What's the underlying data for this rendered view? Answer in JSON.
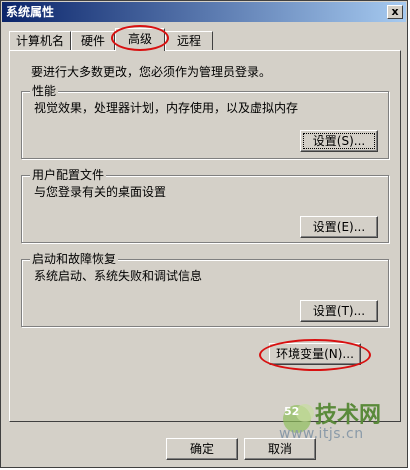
{
  "window": {
    "title": "系统属性",
    "close_glyph": "x"
  },
  "tabs": [
    {
      "label": "计算机名"
    },
    {
      "label": "硬件"
    },
    {
      "label": "高级",
      "active": true
    },
    {
      "label": "远程"
    }
  ],
  "intro_text": "要进行大多数更改，您必须作为管理员登录。",
  "groups": {
    "performance": {
      "title": "性能",
      "description": "视觉效果，处理器计划，内存使用，以及虚拟内存",
      "button": "设置(S)..."
    },
    "user_profiles": {
      "title": "用户配置文件",
      "description": "与您登录有关的桌面设置",
      "button": "设置(E)..."
    },
    "startup_recovery": {
      "title": "启动和故障恢复",
      "description": "系统启动、系统失败和调试信息",
      "button": "设置(T)..."
    }
  },
  "env_button": "环境变量(N)...",
  "footer": {
    "ok": "确定",
    "cancel": "取消"
  },
  "watermark": {
    "brand": "技术网",
    "url": "www.itjs.cn",
    "badge": "52"
  },
  "colors": {
    "annotation": "#d81010",
    "titlebar": "#0a246a"
  }
}
